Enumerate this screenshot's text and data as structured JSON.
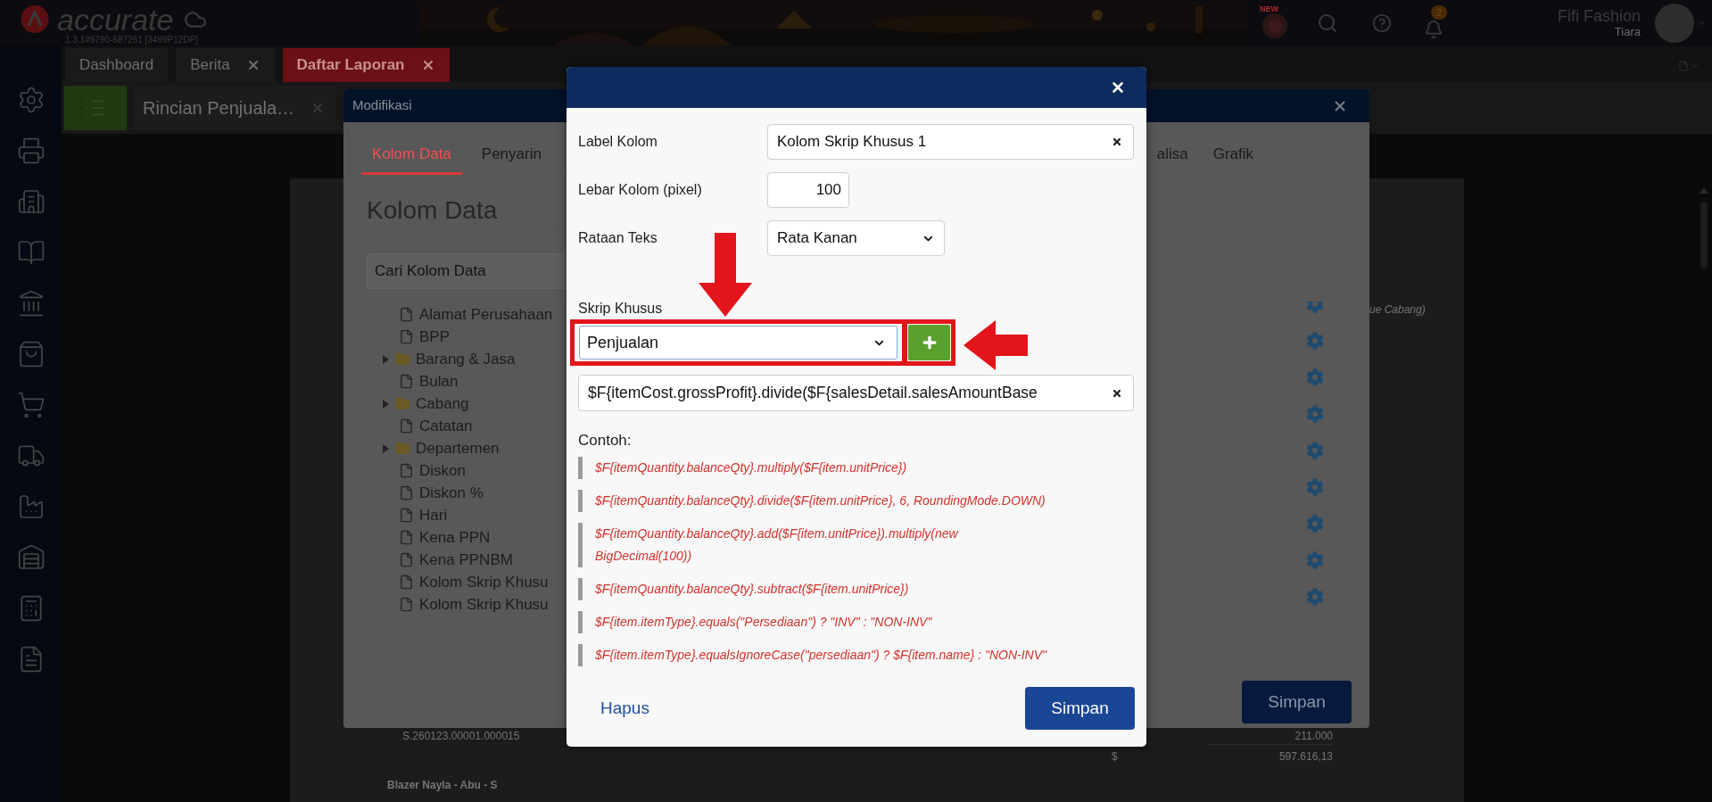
{
  "header": {
    "logo_text": "accurate",
    "version": "1.3.1#9790-687261 [3499P12DP]",
    "new_badge": "NEW",
    "notification_count": "2",
    "company": "Fifi Fashion",
    "user": "Tiara"
  },
  "main_tabs": [
    {
      "label": "Dashboard",
      "selected": false,
      "closable": false
    },
    {
      "label": "Berita",
      "selected": false,
      "closable": true
    },
    {
      "label": "Daftar Laporan",
      "selected": true,
      "closable": true
    }
  ],
  "sub_tab": {
    "label": "Rincian Penjuala…"
  },
  "report": {
    "note": "ue Cabang)",
    "rows": [
      {
        "kind": "detail",
        "column_1": "S.260123.00001.000015",
        "column_5": "211.000"
      },
      {
        "kind": "total",
        "column_3": "$",
        "column_5": "597.616,13"
      },
      {
        "kind": "group",
        "column_1": "Blazer Nayla - Abu - S"
      }
    ]
  },
  "background_dialog": {
    "title": "Modifikasi",
    "tabs": [
      {
        "label": "Kolom Data",
        "selected": true
      },
      {
        "label": "Penyarin",
        "selected": false
      },
      {
        "label": "alisa",
        "selected": false
      },
      {
        "label": "Grafik",
        "selected": false
      }
    ],
    "heading": "Kolom Data",
    "search": {
      "placeholder": "Cari Kolom Data"
    },
    "tree": [
      {
        "kind": "file",
        "label": "Alamat Perusahaan"
      },
      {
        "kind": "file",
        "label": "BPP"
      },
      {
        "kind": "folder",
        "label": "Barang & Jasa",
        "expanded": false
      },
      {
        "kind": "file",
        "label": "Bulan"
      },
      {
        "kind": "folder",
        "label": "Cabang",
        "expanded": false
      },
      {
        "kind": "file",
        "label": "Catatan"
      },
      {
        "kind": "folder",
        "label": "Departemen",
        "expanded": false
      },
      {
        "kind": "file",
        "label": "Diskon"
      },
      {
        "kind": "file",
        "label": "Diskon %"
      },
      {
        "kind": "file",
        "label": "Hari"
      },
      {
        "kind": "file",
        "label": "Kena PPN"
      },
      {
        "kind": "file",
        "label": "Kena PPNBM"
      },
      {
        "kind": "file",
        "label": "Kolom Skrip Khusu"
      },
      {
        "kind": "file",
        "label": "Kolom Skrip Khusu"
      }
    ],
    "save_button": "Simpan"
  },
  "modal": {
    "fields": [
      {
        "kind": "text",
        "label": "Label Kolom",
        "value": "Kolom Skrip Khusus 1"
      },
      {
        "kind": "number",
        "label": "Lebar Kolom (pixel)",
        "value": "100"
      },
      {
        "kind": "select",
        "label": "Rataan Teks",
        "value": "Rata Kanan"
      }
    ],
    "script": {
      "label": "Skrip Khusus",
      "category": "Penjualan",
      "category_highlighted": true,
      "add_button_highlighted": true,
      "value": "$F{itemCost.grossProfit}.divide($F{salesDetail.salesAmountBase"
    },
    "examples_label": "Contoh:",
    "examples": [
      "$F{itemQuantity.balanceQty}.multiply($F{item.unitPrice})",
      "$F{itemQuantity.balanceQty}.divide($F{item.unitPrice}, 6, RoundingMode.DOWN)",
      "$F{itemQuantity.balanceQty}.add($F{item.unitPrice}).multiply(new\nBigDecimal(100))",
      "$F{itemQuantity.balanceQty}.subtract($F{item.unitPrice})",
      "$F{item.itemType}.equals(\"Persediaan\") ? \"INV\" : \"NON-INV\"",
      "$F{item.itemType}.equalsIgnoreCase(\"persediaan\") ? $F{item.name} : \"NON-INV\""
    ],
    "delete_link": "Hapus",
    "save_button": "Simpan"
  }
}
